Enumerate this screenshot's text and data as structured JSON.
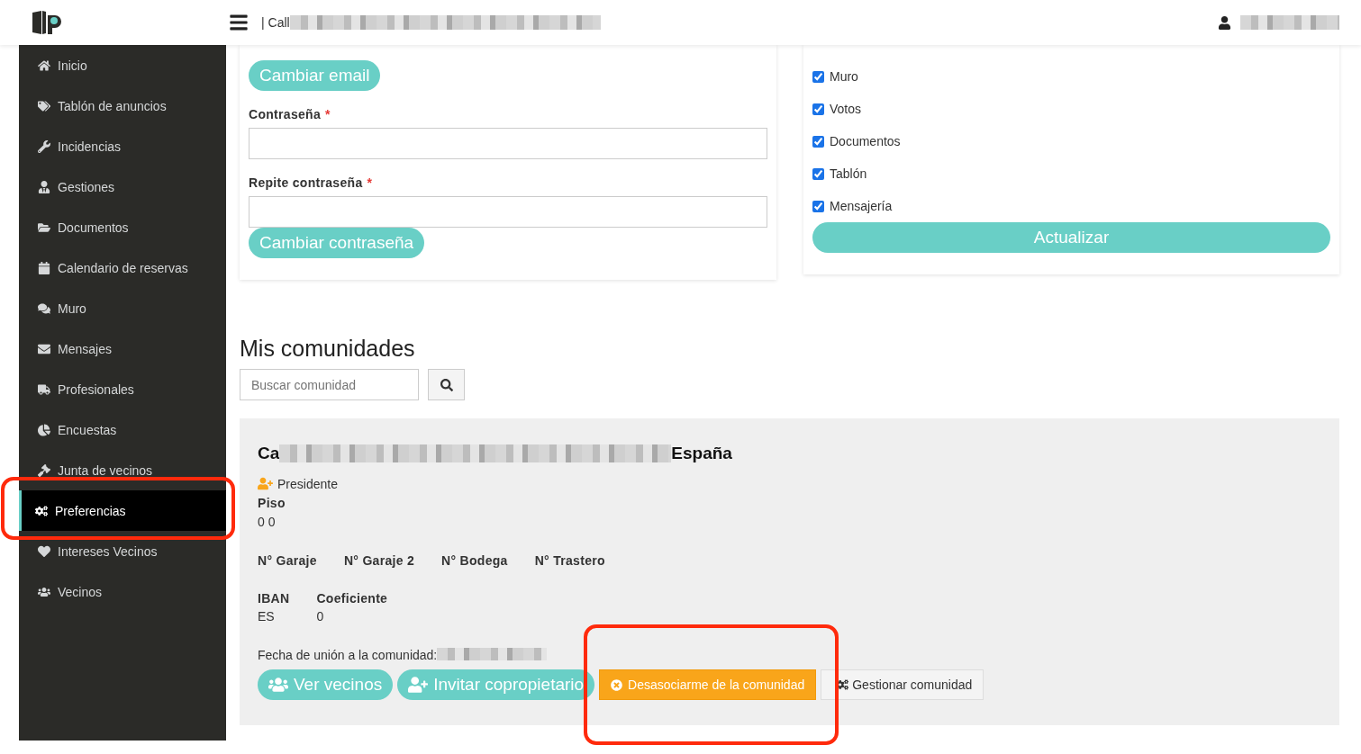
{
  "header": {
    "address": "| Call"
  },
  "sidebar": {
    "items": [
      {
        "label": "Inicio",
        "selected": false
      },
      {
        "label": "Tablón de anuncios",
        "selected": false
      },
      {
        "label": "Incidencias",
        "selected": false
      },
      {
        "label": "Gestiones",
        "selected": false
      },
      {
        "label": "Documentos",
        "selected": false
      },
      {
        "label": "Calendario de reservas",
        "selected": false
      },
      {
        "label": "Muro",
        "selected": false
      },
      {
        "label": "Mensajes",
        "selected": false
      },
      {
        "label": "Profesionales",
        "selected": false
      },
      {
        "label": "Encuestas",
        "selected": false
      },
      {
        "label": "Junta de vecinos",
        "selected": false
      },
      {
        "label": "Preferencias",
        "selected": true
      },
      {
        "label": "Intereses Vecinos",
        "selected": false
      },
      {
        "label": "Vecinos",
        "selected": false
      }
    ]
  },
  "account_form": {
    "change_email_button": "Cambiar email",
    "fields": [
      {
        "label": "Contraseña",
        "required_mark": "*"
      },
      {
        "label": "Repite contraseña",
        "required_mark": "*"
      }
    ],
    "change_password_button": "Cambiar contraseña"
  },
  "notifications": {
    "options": [
      {
        "label": "Muro",
        "checked": true
      },
      {
        "label": "Votos",
        "checked": true
      },
      {
        "label": "Documentos",
        "checked": true
      },
      {
        "label": "Tablón",
        "checked": true
      },
      {
        "label": "Mensajería",
        "checked": true
      }
    ],
    "update_button": "Actualizar"
  },
  "communities": {
    "title": "Mis comunidades",
    "search": {
      "placeholder": "Buscar comunidad"
    },
    "community": {
      "name_start": "Ca",
      "name_end": "España",
      "role": "Presidente",
      "floor_label": "Piso",
      "floor_value": "0 0",
      "storage_labels": [
        "N° Garaje",
        "N° Garaje 2",
        "N° Bodega",
        "N° Trastero"
      ],
      "iban_label": "IBAN",
      "iban_value": "ES",
      "coefficient_label": "Coeficiente",
      "coefficient_value": "0",
      "joined_label": "Fecha de unión a la comunidad:",
      "actions": [
        {
          "label": "Ver vecinos",
          "kind": "pill"
        },
        {
          "label": "Invitar copropietario",
          "kind": "pill"
        },
        {
          "label": "Desasociarme de la comunidad",
          "kind": "warning"
        },
        {
          "label": "Gestionar comunidad",
          "kind": "outline"
        }
      ]
    }
  }
}
